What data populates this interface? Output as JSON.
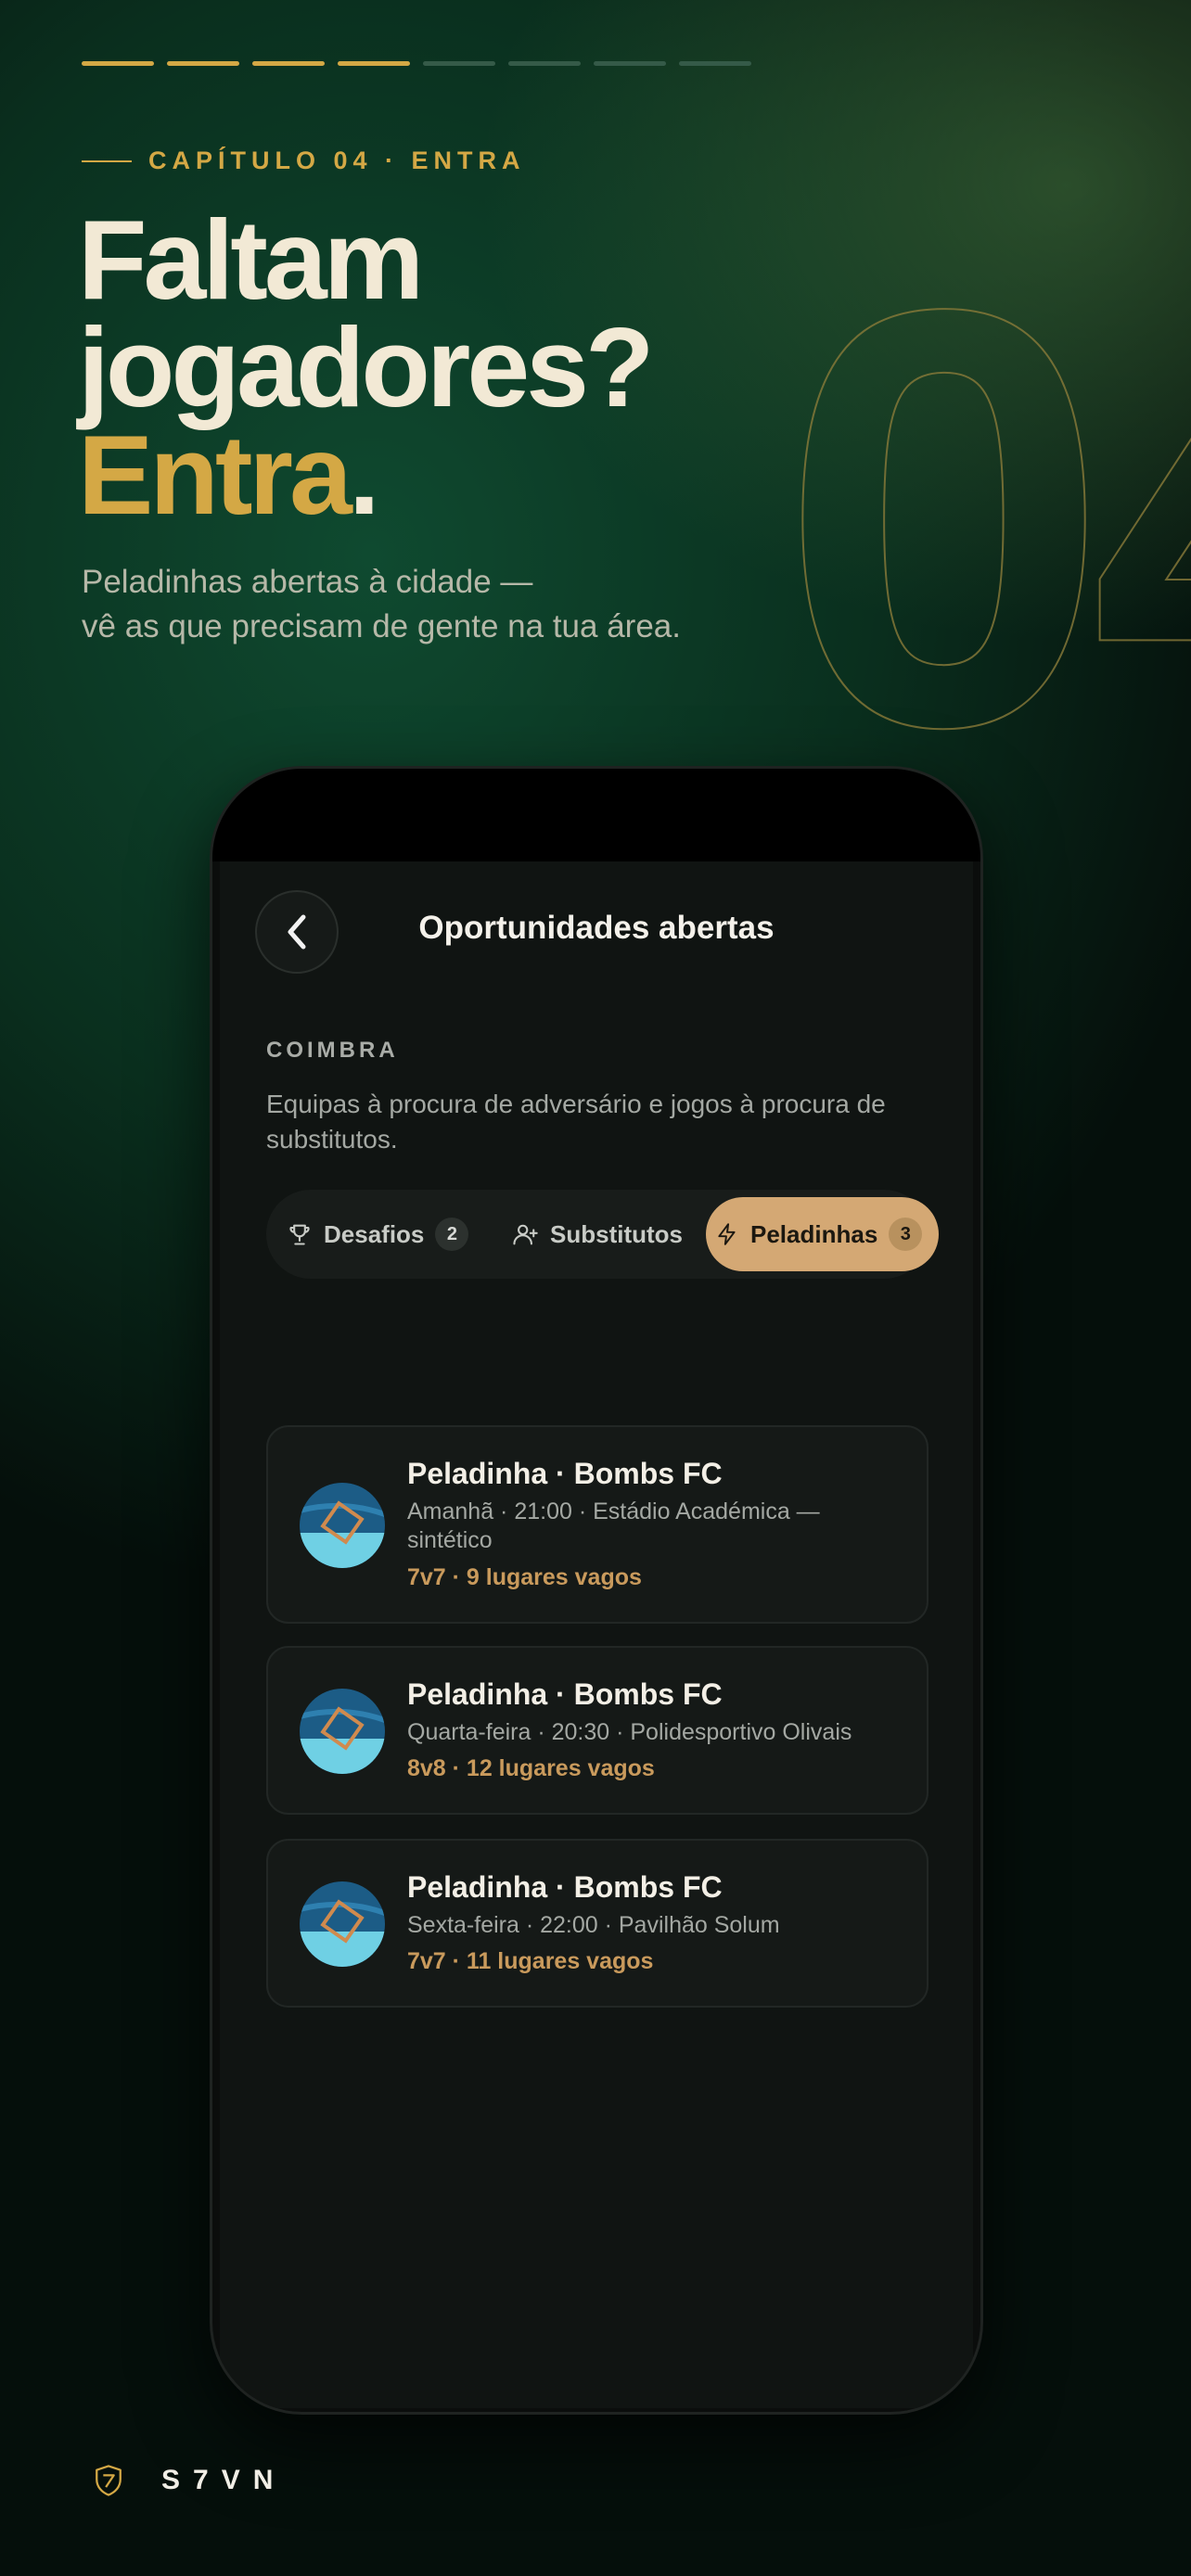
{
  "progress": {
    "total": 8,
    "completed": 4
  },
  "chapter": {
    "label": "CAPÍTULO 04 · ENTRA"
  },
  "headline": {
    "line1": "Faltam",
    "line2": "jogadores?",
    "line3": "Entra",
    "dot": "."
  },
  "subtitle": {
    "line1": "Peladinhas abertas à cidade —",
    "line2": "vê as que precisam de gente na tua área."
  },
  "big_number": "04",
  "screen": {
    "title": "Oportunidades abertas",
    "back_icon": "chevron-left-icon",
    "city": "COIMBRA",
    "description": "Equipas à procura de adversário e jogos à procura de substitutos.",
    "tabs": [
      {
        "label": "Desafios",
        "icon": "trophy-icon",
        "count": "2",
        "active": false
      },
      {
        "label": "Substitutos",
        "icon": "user-plus-icon",
        "count": "",
        "active": false
      },
      {
        "label": "Peladinhas",
        "icon": "lightning-icon",
        "count": "3",
        "active": true
      }
    ],
    "games": [
      {
        "title": "Peladinha · Bombs FC",
        "meta": "Amanhã · 21:00 · Estádio Académica — sintético",
        "spots": "7v7 · 9 lugares vagos"
      },
      {
        "title": "Peladinha · Bombs FC",
        "meta": "Quarta-feira · 20:30 · Polidesportivo Olivais",
        "spots": "8v8 · 12 lugares vagos"
      },
      {
        "title": "Peladinha · Bombs FC",
        "meta": "Sexta-feira · 22:00 · Pavilhão Solum",
        "spots": "7v7 · 11 lugares vagos"
      }
    ]
  },
  "brand": {
    "name": "S7VN",
    "logo": "shield-logo-icon"
  },
  "colors": {
    "accent_gold": "#d4a845",
    "tab_active": "#d4a874",
    "spots": "#c99a5c",
    "background": "#0a2f1e"
  }
}
